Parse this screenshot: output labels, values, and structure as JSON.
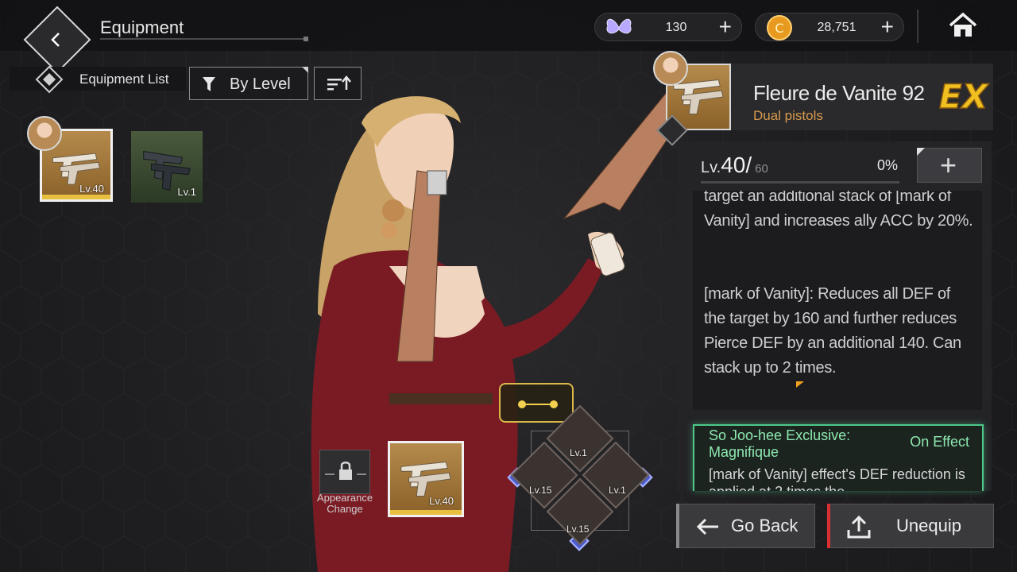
{
  "header": {
    "title": "Equipment",
    "currencies": [
      {
        "icon": "butterfly-icon",
        "value": "130",
        "add_label": "+"
      },
      {
        "icon": "gold-coin-icon",
        "value": "28,751",
        "add_label": "+"
      }
    ]
  },
  "list": {
    "label": "Equipment List",
    "filter_label": "By Level"
  },
  "slots": [
    {
      "level": "Lv.40",
      "equipped": true
    },
    {
      "level": "Lv.1",
      "equipped": false
    }
  ],
  "loadout": {
    "appearance_label": "Appearance Change",
    "main_weapon_level": "Lv.40",
    "runes": [
      {
        "position": "top",
        "level": "Lv.1"
      },
      {
        "position": "left",
        "level": "Lv.15"
      },
      {
        "position": "right",
        "level": "Lv.1"
      },
      {
        "position": "bottom",
        "level": "Lv.15"
      }
    ]
  },
  "detail": {
    "name": "Fleure de Vanite 92",
    "type": "Dual pistols",
    "grade": "EX",
    "level_prefix": "Lv.",
    "level_current": "40/",
    "level_max": "60",
    "exp_percent": "0%",
    "exp_fraction": 0,
    "level_up_label": "+",
    "description": [
      "target an additional stack of [mark of Vanity] and increases ally ACC by 20%.",
      "[mark of Vanity]: Reduces all DEF of the target by 160 and further reduces Pierce DEF by an additional 140. Can stack up to 2 times."
    ],
    "exclusive": {
      "title": "So Joo-hee Exclusive: Magnifique",
      "status": "On Effect",
      "description": "[mark of Vanity] effect's DEF reduction is applied at 2 times the"
    }
  },
  "actions": {
    "go_back_label": "Go Back",
    "unequip_label": "Unequip"
  },
  "colors": {
    "accent_gold": "#e8c040",
    "weapon_type": "#d89a4c",
    "exclusive_green": "#4ec98a",
    "unequip_red": "#d83030"
  }
}
